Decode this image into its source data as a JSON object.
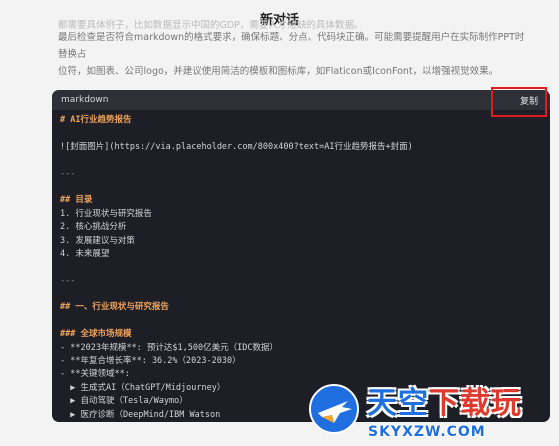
{
  "page": {
    "title": "新对话",
    "intro_faded": "都需要具体例子，比如数据显示中国的GDP，需要人才短缺的具体数据。",
    "intro_line1": "最后检查是否符合markdown的格式要求，确保标题、分点、代码块正确。可能需要提醒用户在实际制作PPT时替换占",
    "intro_line2": "位符，如图表、公司logo，并建议使用简洁的模板和图标库，如Flaticon或IconFont，以增强视觉效果。"
  },
  "code_block": {
    "language": "markdown",
    "copy_label": "复制",
    "lines": [
      {
        "text": "# AI行业趋势报告",
        "style": "heading"
      },
      {
        "text": "",
        "style": "plain"
      },
      {
        "text": "![封面图片](https://via.placeholder.com/800x400?text=AI行业趋势报告+封面)",
        "style": "plain"
      },
      {
        "text": "",
        "style": "plain"
      },
      {
        "text": "---",
        "style": "muted"
      },
      {
        "text": "",
        "style": "plain"
      },
      {
        "text": "## 目录",
        "style": "heading"
      },
      {
        "text": "1. 行业现状与研究报告",
        "style": "plain"
      },
      {
        "text": "2. 核心挑战分析",
        "style": "plain"
      },
      {
        "text": "3. 发展建议与对策",
        "style": "plain"
      },
      {
        "text": "4. 未来展望",
        "style": "plain"
      },
      {
        "text": "",
        "style": "plain"
      },
      {
        "text": "---",
        "style": "muted"
      },
      {
        "text": "",
        "style": "plain"
      },
      {
        "text": "## 一、行业现状与研究报告",
        "style": "heading"
      },
      {
        "text": "",
        "style": "plain"
      },
      {
        "text": "### 全球市场规模",
        "style": "heading"
      },
      {
        "text": "- **2023年规模**: 预计达$1,500亿美元（IDC数据）",
        "style": "plain"
      },
      {
        "text": "- **年复合增长率**: 36.2%（2023-2030）",
        "style": "plain"
      },
      {
        "text": "- **关键领域**:",
        "style": "plain"
      },
      {
        "text": "  ▶ 生成式AI（ChatGPT/Midjourney）",
        "style": "plain"
      },
      {
        "text": "  ▶ 自动驾驶（Tesla/Waymo）",
        "style": "plain"
      },
      {
        "text": "  ▶ 医疗诊断（DeepMind/IBM Watson",
        "style": "plain"
      }
    ]
  },
  "watermark": {
    "title_blue": "天空",
    "title_red": "下载玩",
    "url": "SKYXZW.COM"
  }
}
